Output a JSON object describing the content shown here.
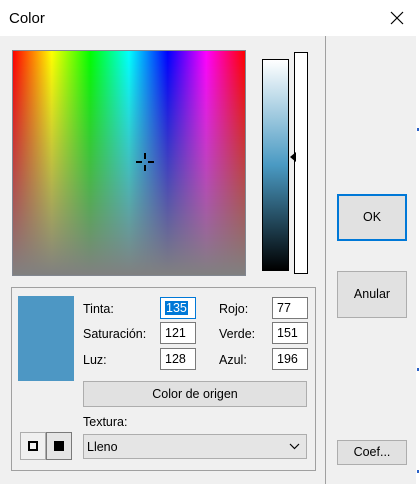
{
  "window": {
    "title": "Color"
  },
  "hsl": {
    "hue_label": "Tinta:",
    "hue_value": "135",
    "sat_label": "Saturación:",
    "sat_value": "121",
    "lum_label": "Luz:",
    "lum_value": "128"
  },
  "rgb": {
    "red_label": "Rojo:",
    "red_value": "77",
    "green_label": "Verde:",
    "green_value": "151",
    "blue_label": "Azul:",
    "blue_value": "196"
  },
  "buttons": {
    "ok": "OK",
    "cancel": "Anular",
    "origin_color": "Color de origen",
    "coef": "Coef..."
  },
  "texture": {
    "label": "Textura:",
    "selected": "Lleno"
  },
  "colors": {
    "current": "#4d97c4",
    "focus": "#0078d7"
  },
  "icons": [
    "close-icon",
    "crosshair-icon",
    "luminance-arrow-icon",
    "dropdown-chevron-icon",
    "texture-outline-icon",
    "texture-filled-icon"
  ]
}
